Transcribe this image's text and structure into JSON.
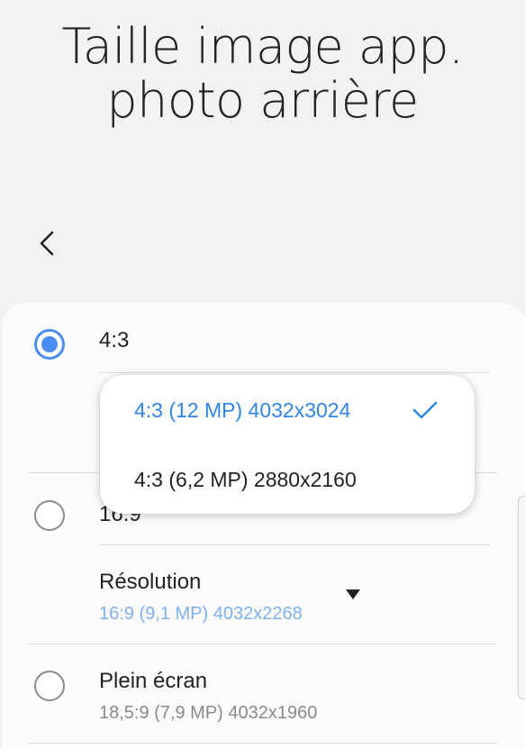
{
  "header": {
    "title_line1": "Taille image app.",
    "title_line2": "photo arrière"
  },
  "options": [
    {
      "label": "4:3",
      "selected": true
    },
    {
      "label": "16:9",
      "selected": false,
      "setting_label": "Résolution",
      "setting_value": "16:9 (9,1 MP) 4032x2268"
    },
    {
      "label": "Plein écran",
      "selected": false,
      "detail": "18,5:9 (7,9 MP) 4032x1960"
    }
  ],
  "popup": {
    "items": [
      {
        "label": "4:3 (12 MP) 4032x3024",
        "selected": true
      },
      {
        "label": "4:3 (6,2 MP) 2880x2160",
        "selected": false
      }
    ]
  },
  "colors": {
    "accent": "#4a8ef5",
    "selected_text": "#2f86e8",
    "value_text": "#7fb1f2"
  }
}
